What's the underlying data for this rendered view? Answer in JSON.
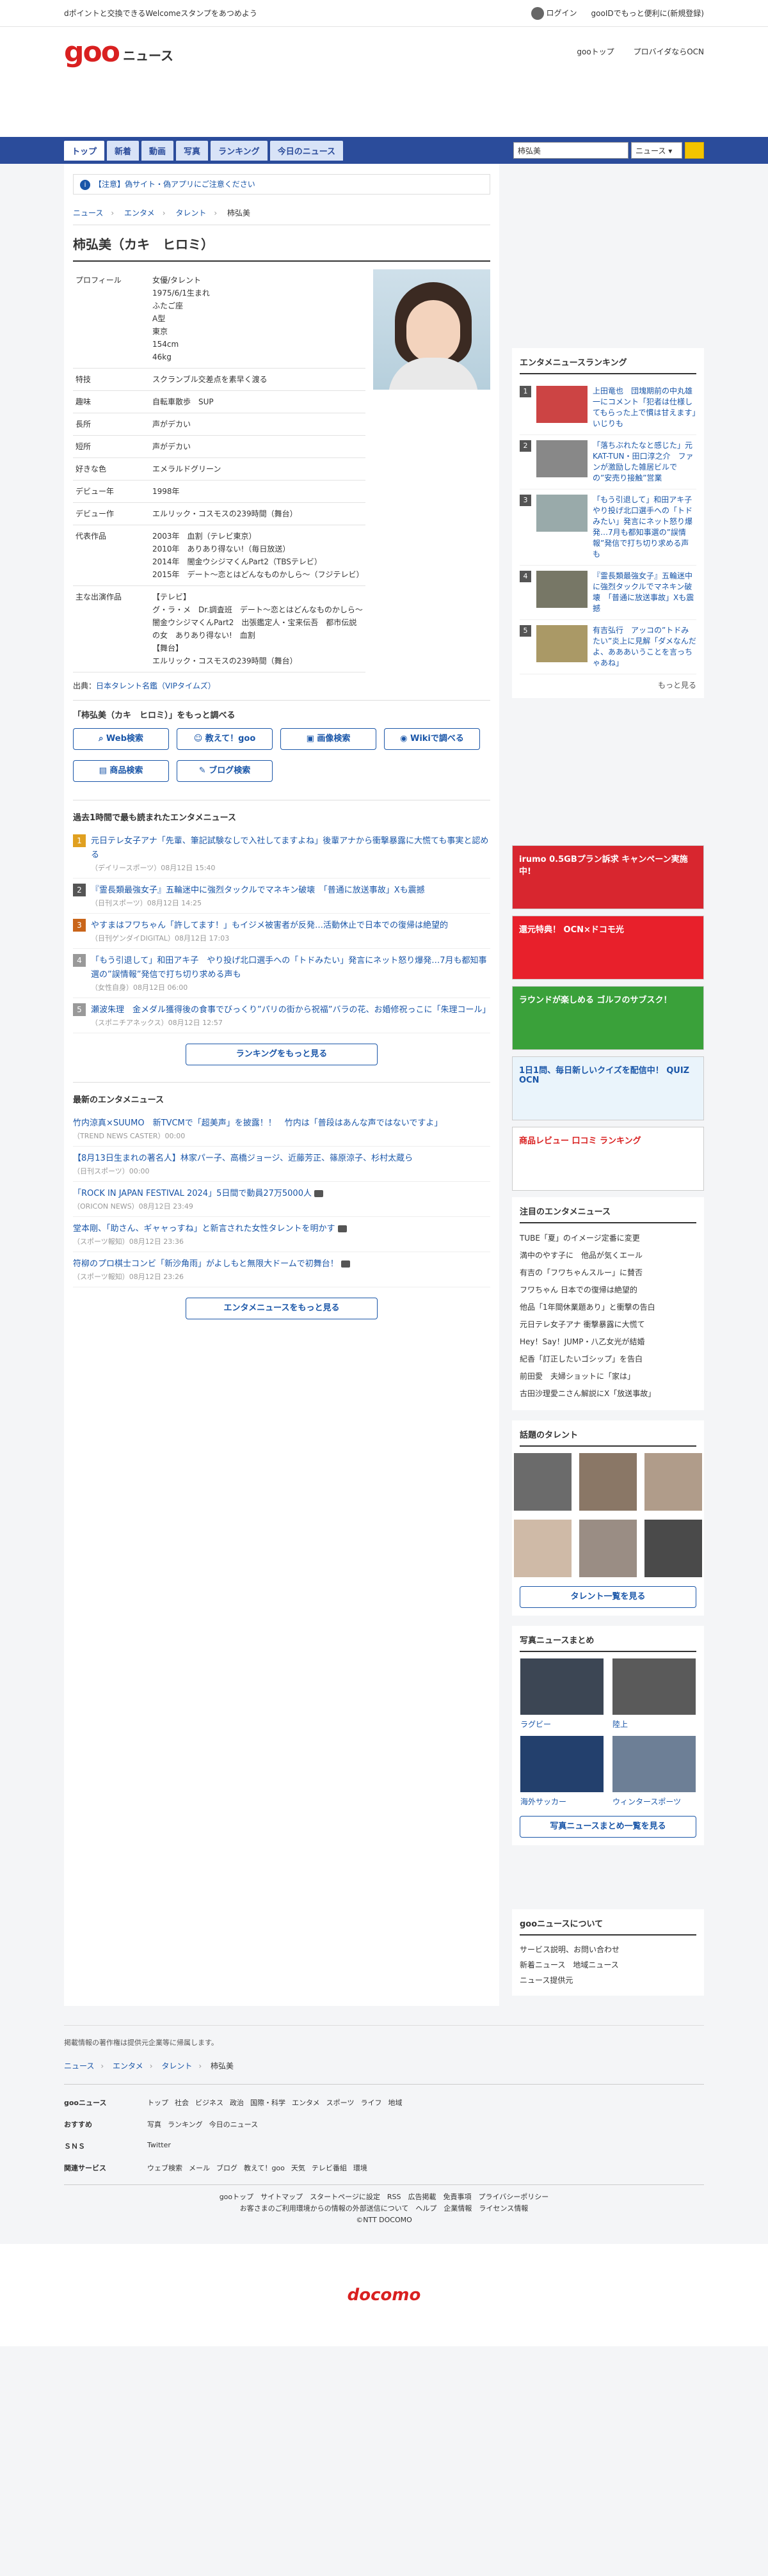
{
  "topbar": {
    "promo": "dポイントと交換できるWelcomeスタンプをあつめよう",
    "login": "ログイン",
    "register": "gooIDでもっと便利に(新規登録)"
  },
  "header": {
    "logo_goo": "goo",
    "logo_news": "ニュース",
    "links": [
      "gooトップ",
      "プロバイダならOCN"
    ]
  },
  "nav": {
    "tabs": [
      "トップ",
      "新着",
      "動画",
      "写真",
      "ランキング",
      "今日のニュース"
    ],
    "search_value": "柿弘美",
    "search_select": "ニュース"
  },
  "warning": "【注意】偽サイト・偽アプリにご注意ください",
  "breadcrumb": [
    "ニュース",
    "エンタメ",
    "タレント",
    "柿弘美"
  ],
  "title": "柿弘美（カキ　ヒロミ）",
  "profile": [
    {
      "k": "プロフィール",
      "v": [
        "女優/タレント",
        "1975/6/1生まれ",
        "ふたご座",
        "A型",
        "東京",
        "154cm",
        "46kg"
      ]
    },
    {
      "k": "特技",
      "v": [
        "スクランブル交差点を素早く渡る"
      ]
    },
    {
      "k": "趣味",
      "v": [
        "自転車散歩　SUP"
      ]
    },
    {
      "k": "長所",
      "v": [
        "声がデカい"
      ]
    },
    {
      "k": "短所",
      "v": [
        "声がデカい"
      ]
    },
    {
      "k": "好きな色",
      "v": [
        "エメラルドグリーン"
      ]
    },
    {
      "k": "デビュー年",
      "v": [
        "1998年"
      ]
    },
    {
      "k": "デビュー作",
      "v": [
        "エルリック・コスモスの239時間（舞台）"
      ]
    },
    {
      "k": "代表作品",
      "v": [
        "2003年　血割（テレビ東京）",
        "2010年　ありあり得ない!（毎日放送）",
        "2014年　闇金ウシジマくんPart2（TBSテレビ）",
        "2015年　デート〜恋とはどんなものかしら〜（フジテレビ）"
      ]
    },
    {
      "k": "主な出演作品",
      "v": [
        "【テレビ】",
        "グ・ラ・メ　Dr.調査班　デート〜恋とはどんなものかしら〜　闇金ウシジマくんPart2　出張鑑定人・宝来伝吾　都市伝説の女　ありあり得ない!　血割",
        "【舞台】",
        "エルリック・コスモスの239時間（舞台）"
      ]
    }
  ],
  "source": {
    "label": "出典：",
    "link": "日本タレント名鑑（VIPタイムズ）"
  },
  "related": {
    "heading": "「柿弘美（カキ　ヒロミ）」をもっと調べる",
    "buttons": [
      "Web検索",
      "教えて！goo",
      "画像検索",
      "Wikiで調べる",
      "商品検索",
      "ブログ検索"
    ]
  },
  "ranking_section": {
    "heading": "過去1時間で最も読まれたエンタメニュース",
    "items": [
      {
        "t": "元日テレ女子アナ「先輩、筆記試験なしで入社してますよね」後輩アナから衝撃暴露に大慌ても事実と認める",
        "m": "（デイリースポーツ）08月12日 15:40",
        "c": "#e0a020"
      },
      {
        "t": "『霊長類最強女子』五輪迷中に強烈タックルでマネキン破壊　「普通に放送事故」Xも震撼",
        "m": "（日刊スポーツ）08月12日 14:25",
        "c": "#555"
      },
      {
        "t": "やすまはフワちゃん「許してます！」もイジメ被害者が反発…活動休止で日本での復帰は絶望的",
        "m": "（日刊ゲンダイDIGITAL）08月12日 17:03",
        "c": "#c9651a"
      },
      {
        "t": "「もう引退して」和田アキ子　やり投げ北口選手への「トドみたい」発言にネット怒り爆発…7月も都知事選の”誤情報”発信で打ち切り求める声も",
        "m": "（女性自身）08月12日 06:00",
        "c": "#999"
      },
      {
        "t": "瀬波朱理　金メダル獲得後の食事でびっくり”パリの街から祝福”バラの花、お婚修祝っこに「朱理コール」",
        "m": "（スポニチアネックス）08月12日 12:57",
        "c": "#999"
      }
    ],
    "more": "ランキングをもっと見る"
  },
  "latest_section": {
    "heading": "最新のエンタメニュース",
    "items": [
      {
        "t": "竹内涼真×SUUMO　新TVCMで「超美声」を披露！！　竹内は「普段はあんな声ではないですよ」",
        "m": "（TREND NEWS CASTER）00:00"
      },
      {
        "t": "【8月13日生まれの著名人】林家パー子、高橋ジョージ、近藤芳正、篠原涼子、杉村太蔵ら",
        "m": "（日刊スポーツ）00:00"
      },
      {
        "t": "「ROCK IN JAPAN FESTIVAL 2024」5日間で動員27万5000人",
        "m": "（ORICON NEWS）08月12日 23:49"
      },
      {
        "t": "堂本剛、「助さん、ギャャっすね」と新言された女性タレントを明かす",
        "m": "（スポーツ報知）08月12日 23:36"
      },
      {
        "t": "符柳のプロ棋士コンビ「新沙角雨」がよしもと無限大ドームで初舞台！",
        "m": "（スポーツ報知）08月12日 23:26"
      }
    ],
    "more": "エンタメニュースをもっと見る"
  },
  "side_ranking": {
    "heading": "エンタメニュースランキング",
    "items": [
      "上田竜也　団塊期前の中丸雄一にコメント「犯者は仕様してもらった上で慣は甘えます」　いじりも",
      "「落ちぶれたなと感じた」元KAT-TUN・田口淳之介　ファンが激励した雑居ビルでの”安売り接触”営業",
      "「もう引退して」和田アキ子　やり投げ北口選手への「トドみたい」発言にネット怒り爆発…7月も都知事選の”誤情報”発信で打ち切り求める声も",
      "『霊長類最強女子』五輪迷中に強烈タックルでマネキン破壊　「普通に放送事故」Xも震撼",
      "有吉弘行　アッコの”トドみたい”炎上に見解「ダメなんだよ、あああいうことを言っちゃあね」"
    ],
    "more": "もっと見る"
  },
  "ads": [
    "irumo 0.5GBプラン訴求 キャンペーン実施中!",
    "還元特典！ OCN×ドコモ光",
    "ラウンドが楽しめる ゴルフのサブスク！",
    "1日1問、毎日新しいクイズを配信中！ QUIZ OCN",
    "商品レビュー 口コミ ランキング"
  ],
  "notice": {
    "heading": "注目のエンタメニュース",
    "items": [
      "TUBE「夏」のイメージ定番に変更",
      "満中のやす子に　他品が気くエール",
      "有吉の「フワちゃんスルー」に賛否",
      "フワちゃん 日本での復帰は絶望的",
      "他品「1年間休業題あり」と衝撃の告白",
      "元日テレ女子アナ 衝撃暴露に大慌て",
      "Hey！Say！JUMP・八乙女光が結婚",
      "紀香「訂正したいゴシップ」を告白",
      "前田愛　夫婦ショットに「家は」",
      "古田沙理愛ニさん解説にX「放送事故」"
    ]
  },
  "talents": {
    "heading": "話題のタレント",
    "more": "タレント一覧を見る",
    "colors": [
      "#6b6b6b",
      "#8a7766",
      "#b09c8a",
      "#cfbaa7",
      "#9a8d84",
      "#4a4a4a"
    ]
  },
  "photos": {
    "heading": "写真ニュースまとめ",
    "items": [
      "ラグビー",
      "陸上",
      "海外サッカー",
      "ウィンタースポーツ"
    ],
    "more": "写真ニュースまとめ一覧を見る"
  },
  "about": {
    "heading": "gooニュースについて",
    "items": [
      "サービス説明、お問い合わせ",
      "新着ニュース　地域ニュース",
      "ニュース提供元"
    ]
  },
  "footer": {
    "copynote": "掲載情報の著作権は提供元企業等に帰属します。",
    "breadcrumb": [
      "ニュース",
      "エンタメ",
      "タレント",
      "柿弘美"
    ],
    "rows": [
      {
        "h": "gooニュース",
        "ls": [
          "トップ",
          "社会",
          "ビジネス",
          "政治",
          "国際・科学",
          "エンタメ",
          "スポーツ",
          "ライフ",
          "地域"
        ]
      },
      {
        "h": "おすすめ",
        "ls": [
          "写真",
          "ランキング",
          "今日のニュース"
        ]
      },
      {
        "h": "ＳＮＳ",
        "ls": [
          "Twitter"
        ]
      },
      {
        "h": "関連サービス",
        "ls": [
          "ウェブ検索",
          "メール",
          "ブログ",
          "教えて！goo",
          "天気",
          "テレビ番組",
          "環境"
        ]
      }
    ],
    "bottom1": "gooトップ　サイトマップ　スタートページに設定　RSS　広告掲載　免責事項　プライバシーポリシー",
    "bottom2": "お客さまのご利用環境からの情報の外部送信について　ヘルプ　企業情報　ライセンス情報",
    "copyright": "©NTT DOCOMO",
    "brand": "docomo"
  }
}
